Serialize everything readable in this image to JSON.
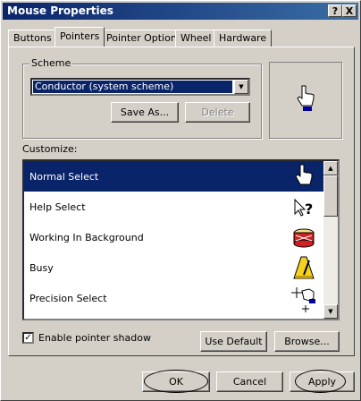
{
  "window": {
    "title": "Mouse Properties",
    "help_button": "?",
    "close_button": "X"
  },
  "tabs": [
    {
      "label": "Buttons"
    },
    {
      "label": "Pointers"
    },
    {
      "label": "Pointer Options"
    },
    {
      "label": "Wheel"
    },
    {
      "label": "Hardware"
    }
  ],
  "scheme": {
    "group_label": "Scheme",
    "selected": "Conductor (system scheme)",
    "save_as": "Save As...",
    "delete": "Delete"
  },
  "customize": {
    "label": "Customize:",
    "items": [
      {
        "label": "Normal Select",
        "icon": "hand-pointer-icon"
      },
      {
        "label": "Help Select",
        "icon": "help-select-icon"
      },
      {
        "label": "Working In Background",
        "icon": "drum-icon"
      },
      {
        "label": "Busy",
        "icon": "metronome-icon"
      },
      {
        "label": "Precision Select",
        "icon": "precision-hand-icon"
      }
    ]
  },
  "options": {
    "shadow_label": "Enable pointer shadow",
    "shadow_checked": true,
    "use_default": "Use Default",
    "browse": "Browse..."
  },
  "footer": {
    "ok": "OK",
    "cancel": "Cancel",
    "apply": "Apply"
  }
}
